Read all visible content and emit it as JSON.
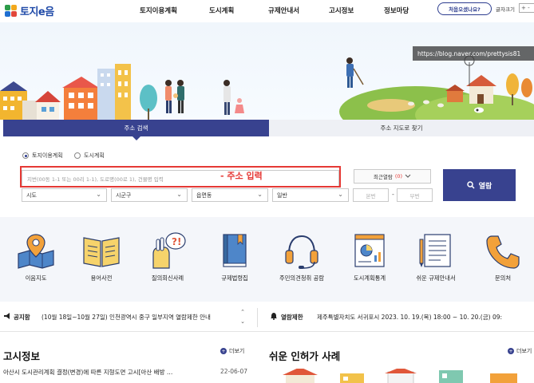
{
  "header": {
    "logo_text": "토지e음",
    "nav": [
      "토지이용계획",
      "도시계획",
      "규제안내서",
      "고시정보",
      "정보마당"
    ],
    "first_visit_button": "처음오셨나요?",
    "font_size_label": "글자크기",
    "font_size_control": "+ -"
  },
  "hero": {
    "watermark": "https://blog.naver.com/prettysis81"
  },
  "search": {
    "tabs": [
      "주소 검색",
      "주소 지도로 찾기"
    ],
    "radios": [
      {
        "label": "토지이용계획",
        "checked": true
      },
      {
        "label": "도시계획",
        "checked": false
      }
    ],
    "address_placeholder": "지번(00동 1-1 또는 00리 1-1), 도로명(00로 1), 건물명 입력",
    "annotation": "- 주소 입력",
    "recent_label": "최근열람",
    "recent_count": "(0)",
    "open_button": "열람",
    "selects": [
      "시도",
      "시군구",
      "읍면동",
      "일반"
    ],
    "main_no_placeholder": "본번",
    "sub_no_placeholder": "부번",
    "dash": "-"
  },
  "services": [
    {
      "label": "이음지도",
      "icon": "map-pin-icon"
    },
    {
      "label": "용어사전",
      "icon": "book-icon"
    },
    {
      "label": "질의회신사례",
      "icon": "question-person-icon"
    },
    {
      "label": "규제법령집",
      "icon": "law-book-icon"
    },
    {
      "label": "주민의견청취 공람",
      "icon": "headset-icon"
    },
    {
      "label": "도시계획통계",
      "icon": "statistics-icon"
    },
    {
      "label": "쉬운 규제안내서",
      "icon": "document-icon"
    },
    {
      "label": "문의처",
      "icon": "phone-icon"
    }
  ],
  "notices": {
    "notice_title": "공지함",
    "notice_text": "(10월 18일~10월 27일) 인천광역시 중구 일부지역 열람제한 안내",
    "restriction_title": "열람제한",
    "restriction_text": "제주특별자치도 서귀포시 2023. 10. 19.(목) 18:00 ~ 10. 20.(금) 09:"
  },
  "gosi": {
    "title": "고시정보",
    "more": "더보기",
    "items": [
      {
        "text": "아산시 도시관리계획 결정(변경)에 따른 지형도면 고시[아산 배방 …",
        "date": "22-06-07"
      }
    ]
  },
  "cases": {
    "title": "쉬운 인허가 사례",
    "more": "더보기"
  },
  "colors": {
    "brand_navy": "#38428f",
    "highlight_red": "#e53935",
    "logo_blue": "#1f4aa8"
  }
}
